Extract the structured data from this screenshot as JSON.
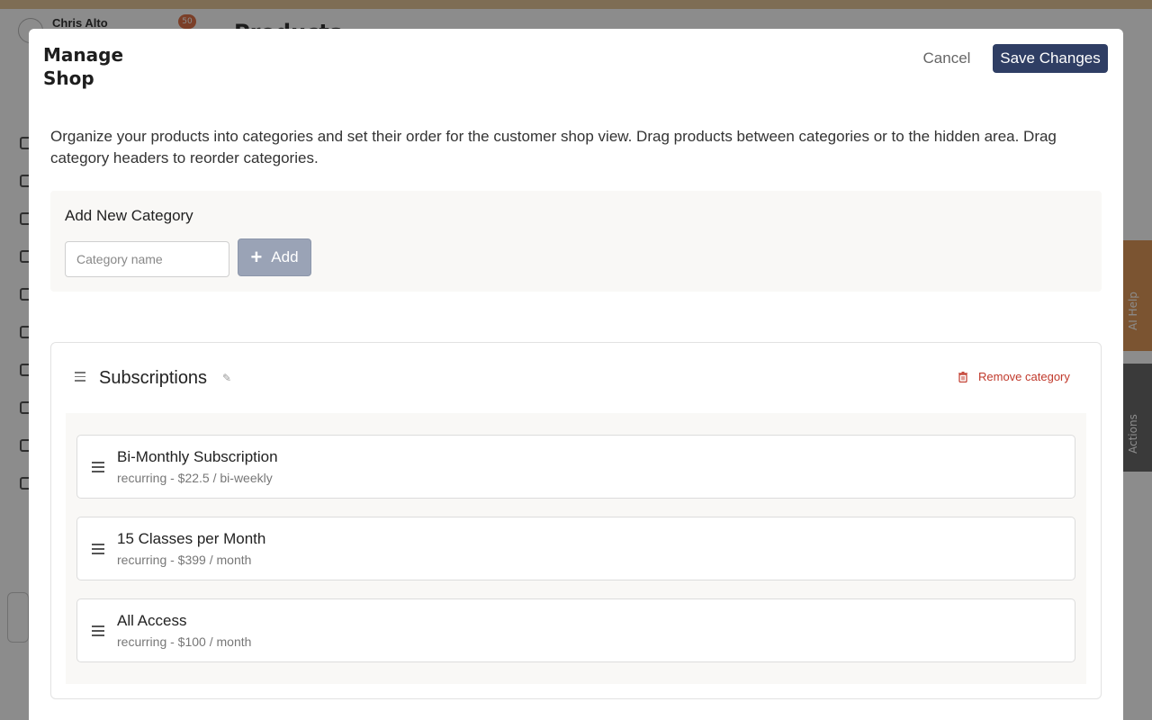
{
  "background": {
    "user_name": "Chris Alto",
    "badge_count": "50",
    "heading": "Products",
    "ai_help_label": "AI Help",
    "actions_label": "Actions"
  },
  "modal": {
    "title": "Manage Shop",
    "cancel_label": "Cancel",
    "save_label": "Save Changes",
    "description": "Organize your products into categories and set their order for the customer shop view. Drag products between categories or to the hidden area. Drag category headers to reorder categories.",
    "add_category": {
      "title": "Add New Category",
      "placeholder": "Category name",
      "value": "",
      "button_label": "Add"
    },
    "categories": [
      {
        "name": "Subscriptions",
        "remove_label": "Remove category",
        "products": [
          {
            "name": "Bi-Monthly Subscription",
            "meta": "recurring - $22.5 / bi-weekly"
          },
          {
            "name": "15 Classes per Month",
            "meta": "recurring - $399 / month"
          },
          {
            "name": "All Access",
            "meta": "recurring - $100 / month"
          }
        ]
      }
    ]
  },
  "colors": {
    "primary_button": "#2f3e64",
    "danger": "#c0392b",
    "panel_bg": "#f9f8f6"
  }
}
